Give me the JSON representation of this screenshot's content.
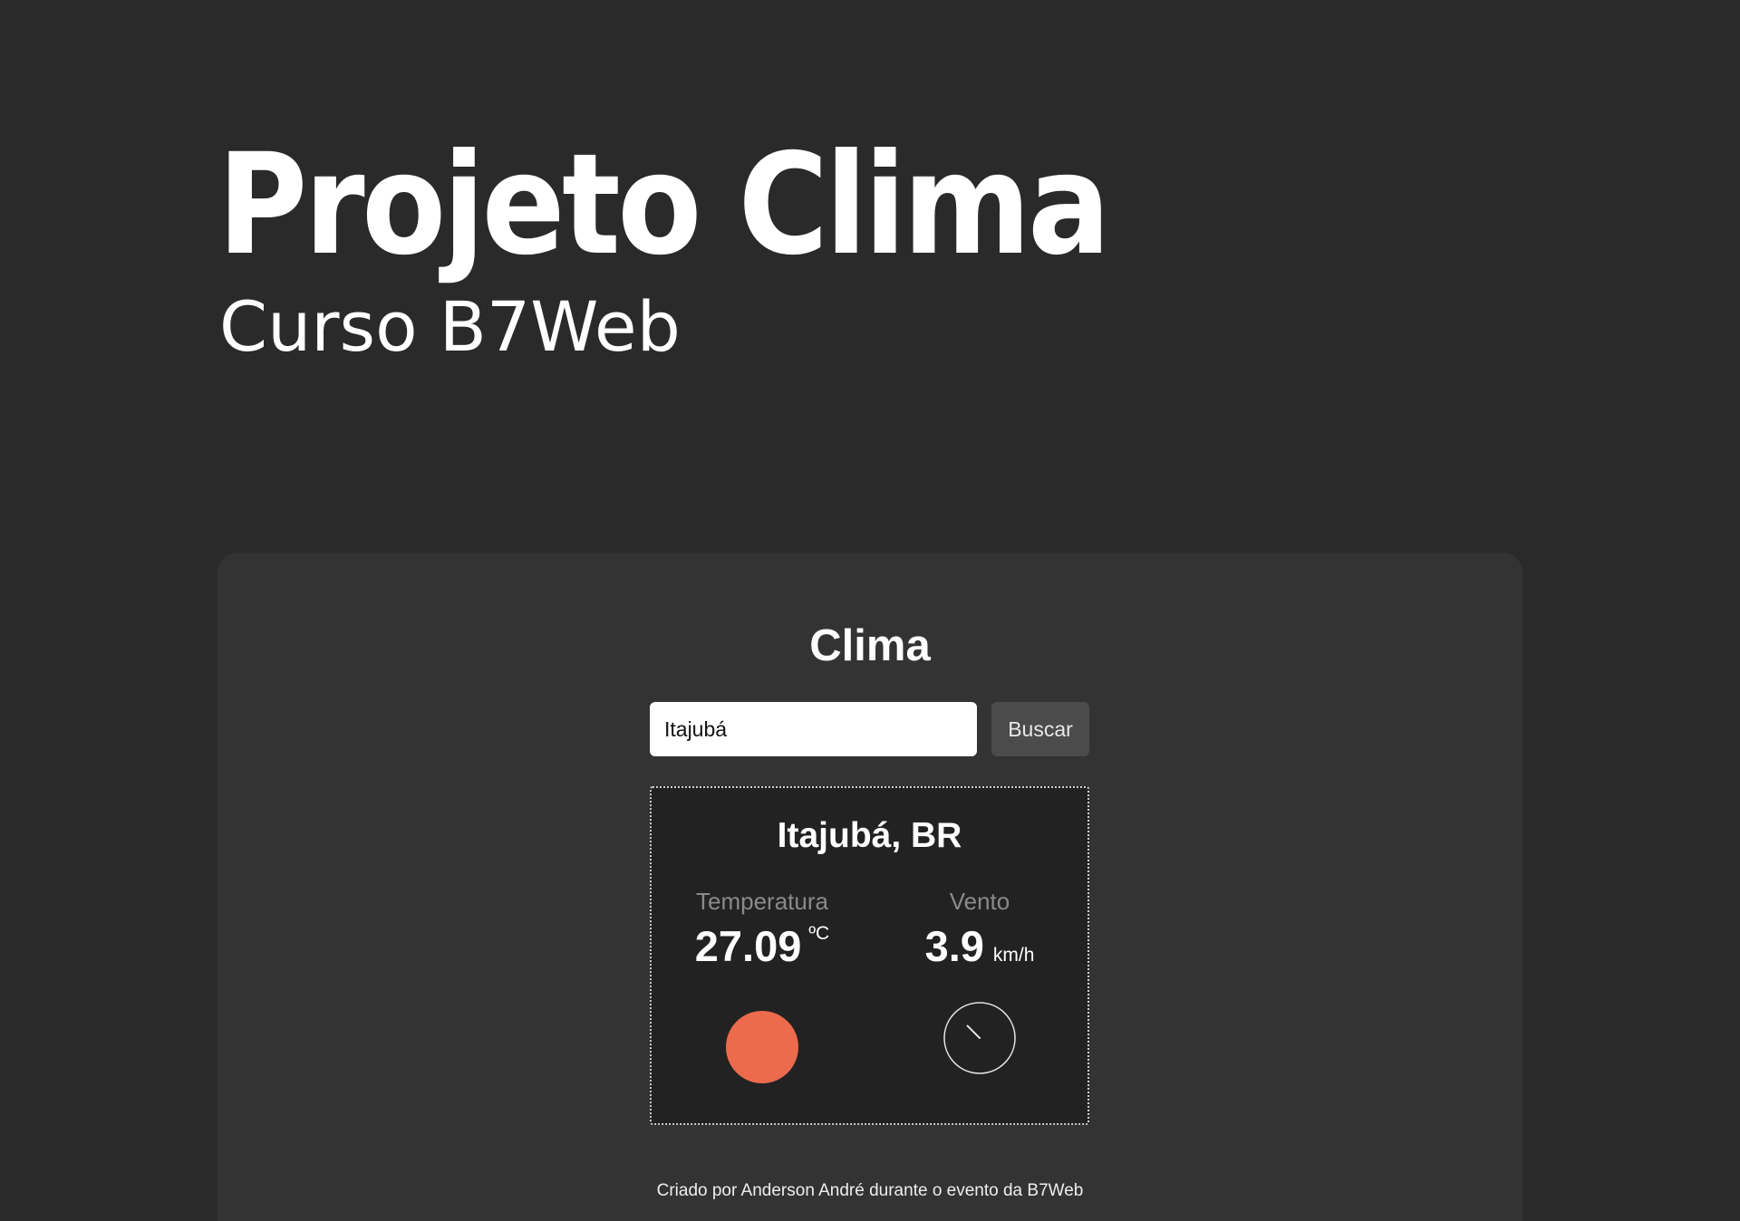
{
  "header": {
    "title": "Projeto Clima",
    "subtitle": "Curso B7Web"
  },
  "weather_card": {
    "title": "Clima",
    "search": {
      "value": "Itajubá",
      "button_label": "Buscar"
    },
    "result": {
      "location": "Itajubá, BR",
      "temperature": {
        "label": "Temperatura",
        "value": "27.09",
        "unit": "ºC",
        "indicator_color": "#ec6b4c"
      },
      "wind": {
        "label": "Vento",
        "value": "3.9",
        "unit": "km/h",
        "direction_deg": 135
      }
    },
    "footer": "Criado por Anderson André durante o evento da B7Web"
  }
}
